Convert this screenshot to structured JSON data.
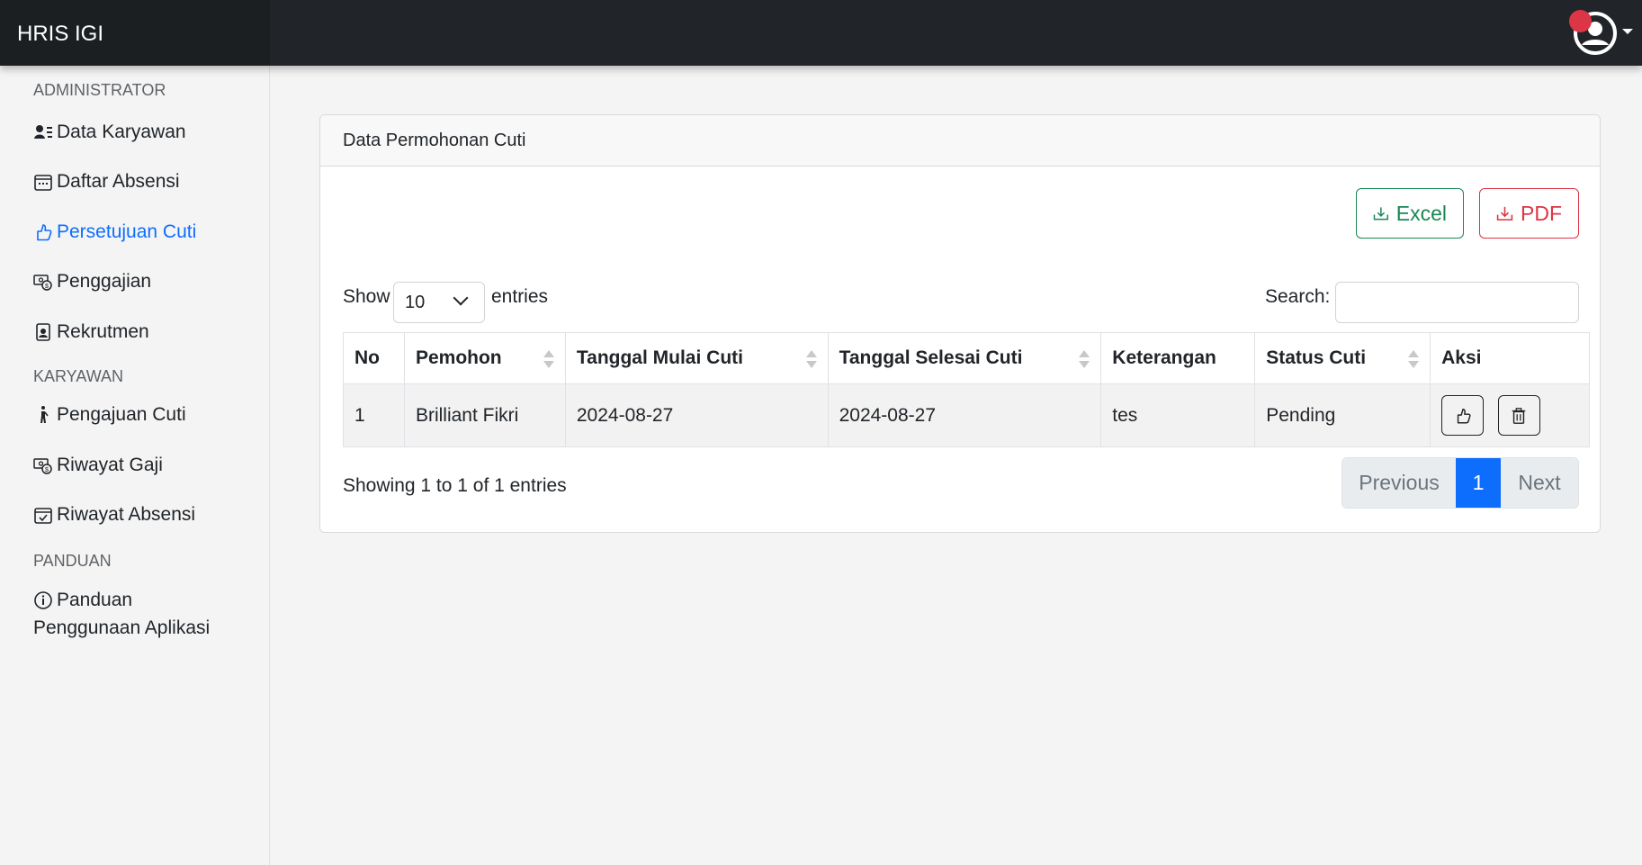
{
  "app": {
    "title": "HRIS IGI"
  },
  "sidebar": {
    "headings": [
      "ADMINISTRATOR",
      "KARYAWAN",
      "PANDUAN"
    ],
    "items": [
      {
        "label": "Data Karyawan",
        "icon": "person-lines-icon"
      },
      {
        "label": "Daftar Absensi",
        "icon": "calendar-icon"
      },
      {
        "label": "Persetujuan Cuti",
        "icon": "thumbs-up-icon",
        "active": true
      },
      {
        "label": "Penggajian",
        "icon": "cash-coin-icon"
      },
      {
        "label": "Rekrutmen",
        "icon": "person-badge-icon"
      },
      {
        "label": "Pengajuan Cuti",
        "icon": "person-walking-icon"
      },
      {
        "label": "Riwayat Gaji",
        "icon": "cash-coin-icon"
      },
      {
        "label": "Riwayat Absensi",
        "icon": "calendar-check-icon"
      },
      {
        "label": "Panduan",
        "label2": "Penggunaan Aplikasi",
        "icon": "info-circle-icon"
      }
    ]
  },
  "card": {
    "title": "Data Permohonan Cuti",
    "excel_label": "Excel",
    "pdf_label": "PDF",
    "show_label": "Show",
    "entries_value": "10",
    "entries_label": "entries",
    "search_label": "Search:",
    "search_value": ""
  },
  "table": {
    "headers": [
      "No",
      "Pemohon",
      "Tanggal Mulai Cuti",
      "Tanggal Selesai Cuti",
      "Keterangan",
      "Status Cuti",
      "Aksi"
    ],
    "rows": [
      [
        "1",
        "Brilliant Fikri",
        "2024-08-27",
        "2024-08-27",
        "tes",
        "Pending"
      ]
    ]
  },
  "footer": {
    "showing": "Showing 1 to 1 of 1 entries",
    "prev": "Previous",
    "page": "1",
    "next": "Next"
  },
  "colors": {
    "topbar": "#212529",
    "accent": "#0d6efd",
    "excel": "#198754",
    "pdf": "#dc3545",
    "notification": "#dc3545"
  }
}
